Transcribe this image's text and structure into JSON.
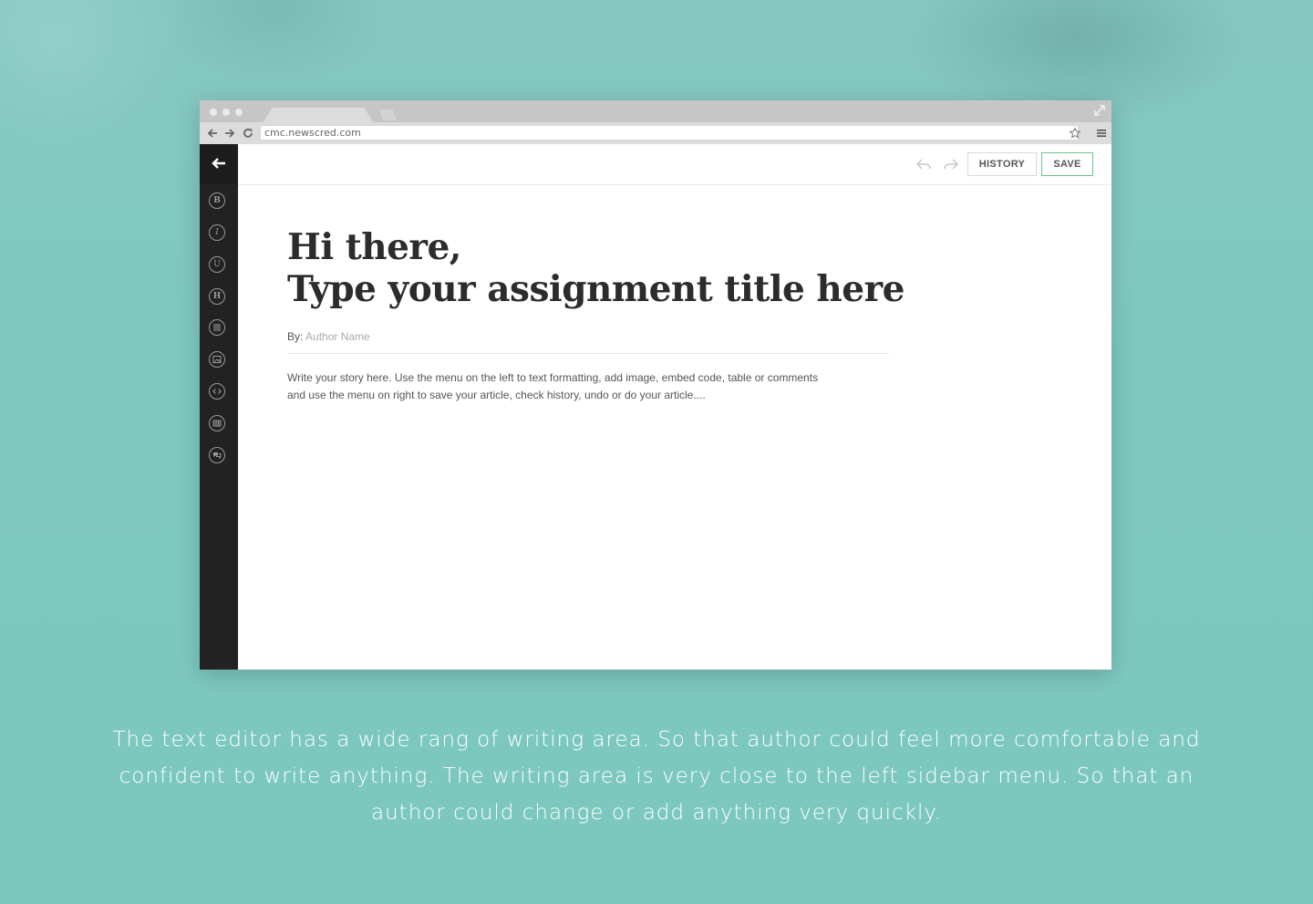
{
  "browser": {
    "url": "cmc.newscred.com"
  },
  "sidebar": {
    "tools": [
      {
        "icon": "bold-icon",
        "glyph": "B"
      },
      {
        "icon": "italic-icon",
        "glyph": "I"
      },
      {
        "icon": "underline-icon",
        "glyph": "U"
      },
      {
        "icon": "heading-icon",
        "glyph": "H"
      },
      {
        "icon": "align-icon"
      },
      {
        "icon": "image-icon"
      },
      {
        "icon": "embed-code-icon"
      },
      {
        "icon": "table-icon"
      },
      {
        "icon": "comments-icon"
      }
    ]
  },
  "toolbar": {
    "history_label": "HISTORY",
    "save_label": "SAVE",
    "save_accent": "#6cc48a"
  },
  "editor": {
    "title_line1": "Hi there,",
    "title_line2": "Type your assignment title here",
    "by_label": "By:",
    "author_placeholder": "Author Name",
    "body_line1": "Write your story here. Use the menu on the left to text formatting, add image, embed code, table or comments",
    "body_line2": "and use the menu on right to save your article, check history, undo or do your article...."
  },
  "caption": {
    "line1": "The text editor has a wide rang of writing area. So that author could feel more comfortable and",
    "line2": "confident to write anything. The writing area is very close to the left sidebar menu. So that an",
    "line3": "author could change or add anything very quickly."
  }
}
